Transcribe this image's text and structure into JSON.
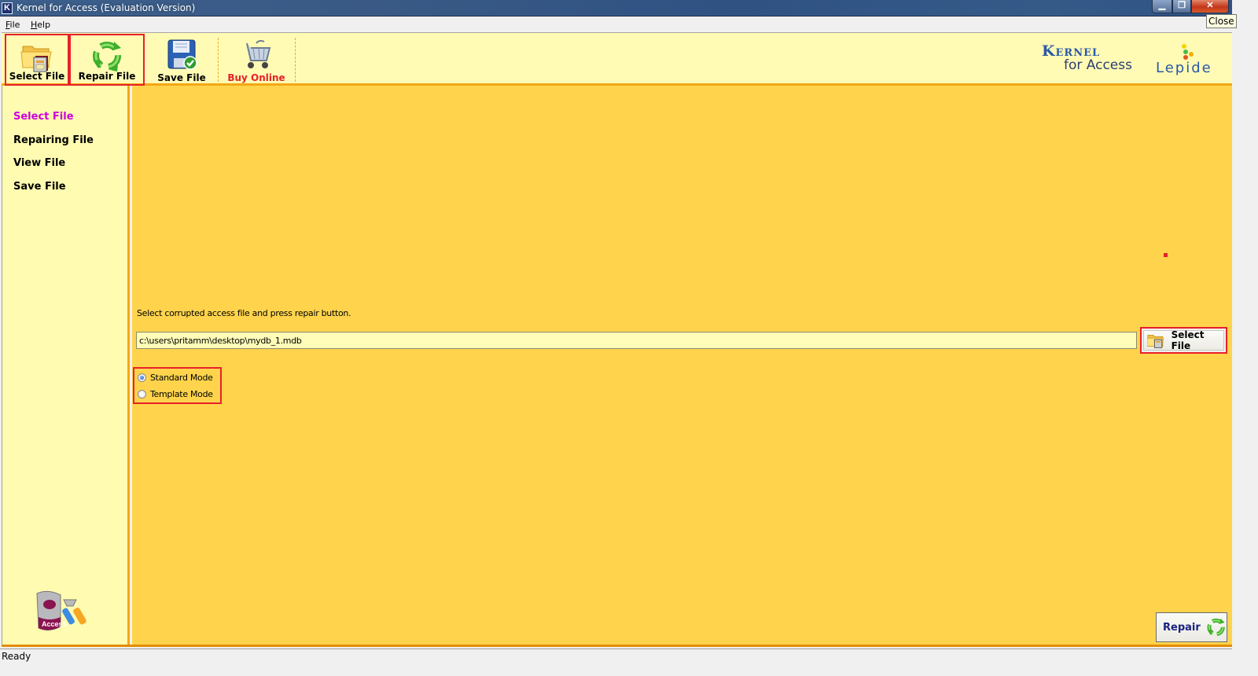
{
  "window": {
    "title": "Kernel for Access (Evaluation Version)",
    "app_icon_letter": "K",
    "controls": {
      "minimize": "minimize-icon",
      "restore": "restore-icon",
      "close": "close-icon"
    },
    "close_symbol": "✕",
    "minimize_symbol": "▁",
    "restore_symbol": "❐",
    "tooltip": "Close"
  },
  "menu": {
    "items": [
      {
        "label": "File",
        "accel": "F",
        "rest": "ile"
      },
      {
        "label": "Help",
        "accel": "H",
        "rest": "elp"
      }
    ]
  },
  "toolbar": {
    "buttons": [
      {
        "label": "Select File",
        "icon": "folder-file-icon",
        "highlighted": true
      },
      {
        "label": "Repair File",
        "icon": "recycle-arrows-icon",
        "highlighted": true
      },
      {
        "label": "Save File",
        "icon": "floppy-disk-icon",
        "highlighted": false
      },
      {
        "label": "Buy Online",
        "icon": "shopping-cart-icon",
        "highlighted": false,
        "color": "#e8202a"
      }
    ],
    "brand": {
      "name": "Kernel",
      "subtitle": "for Access"
    },
    "vendor": "Lepide"
  },
  "sidebar": {
    "items": [
      {
        "label": "Select File",
        "active": true
      },
      {
        "label": "Repairing File",
        "active": false
      },
      {
        "label": "View File",
        "active": false
      },
      {
        "label": "Save File",
        "active": false
      }
    ],
    "logo_text": "Access"
  },
  "main": {
    "instruction": "Select corrupted access file and press repair button.",
    "file_path": "c:\\users\\pritamm\\desktop\\mydb_1.mdb",
    "browse_button": "Select File",
    "modes": [
      {
        "label": "Standard Mode",
        "checked": true
      },
      {
        "label": "Template Mode",
        "checked": false
      }
    ],
    "repair_button": "Repair"
  },
  "status": {
    "text": "Ready"
  },
  "colors": {
    "accent_red": "#e8202a",
    "active_nav": "#cc00dd",
    "panel_bg": "#ffd44c",
    "sidebar_bg": "#fffbb0",
    "brand_blue": "#2b58a6"
  }
}
